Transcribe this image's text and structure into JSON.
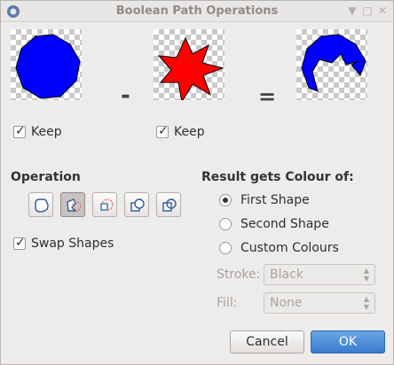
{
  "window": {
    "title": "Boolean Path Operations",
    "controls": [
      "minimize-icon",
      "maximize-icon",
      "close-icon"
    ]
  },
  "shapes": {
    "first": {
      "color": "#0000ff",
      "keep_label": "Keep",
      "keep_checked": true
    },
    "second": {
      "color": "#ff0000",
      "keep_label": "Keep",
      "keep_checked": true
    },
    "result": {
      "color": "#0000ff"
    },
    "minus_sign": "-",
    "equals_sign": "="
  },
  "operation": {
    "title": "Operation",
    "buttons": [
      {
        "name": "union",
        "icon": "union-icon",
        "active": false
      },
      {
        "name": "subtract",
        "icon": "subtract-icon",
        "active": true
      },
      {
        "name": "intersect",
        "icon": "intersection-icon",
        "active": false
      },
      {
        "name": "exclude",
        "icon": "exclude-icon",
        "active": false
      },
      {
        "name": "divide",
        "icon": "divide-icon",
        "active": false
      }
    ],
    "swap_label": "Swap Shapes",
    "swap_checked": true
  },
  "result_colour": {
    "title": "Result gets Colour of:",
    "options": [
      "First Shape",
      "Second Shape",
      "Custom Colours"
    ],
    "selected": "First Shape",
    "stroke_label": "Stroke:",
    "stroke_value": "Black",
    "fill_label": "Fill:",
    "fill_value": "None"
  },
  "buttons": {
    "cancel": "Cancel",
    "ok": "OK"
  }
}
